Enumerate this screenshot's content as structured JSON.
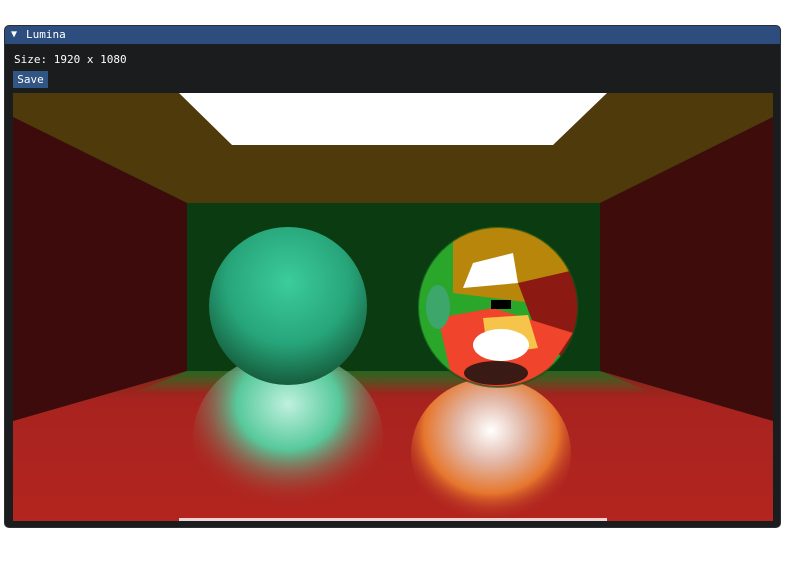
{
  "window": {
    "title": "Lumina",
    "collapse_icon": "triangle-down-icon"
  },
  "panel": {
    "size_label": "Size: 1920 x 1080",
    "save_label": "Save"
  },
  "render": {
    "description_colors": {
      "ceiling": "#4e3a0b",
      "left_wall": "#3d0b0b",
      "right_wall": "#3f0c0c",
      "back_wall": "#0b3b11",
      "floor": "#a8231f",
      "light": "#ffffff",
      "diffuse_sphere": "#2fb38a",
      "mirror_sphere": "#c8641c"
    }
  }
}
